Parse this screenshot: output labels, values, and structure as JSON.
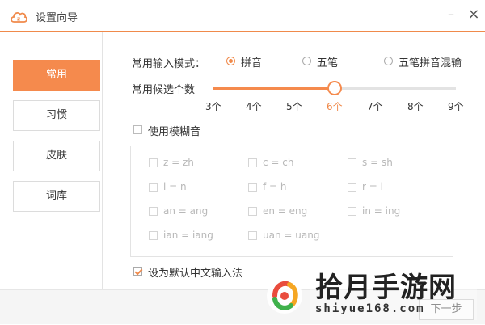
{
  "window": {
    "title": "设置向导"
  },
  "sidebar": {
    "items": [
      {
        "label": "常用",
        "active": true
      },
      {
        "label": "习惯",
        "active": false
      },
      {
        "label": "皮肤",
        "active": false
      },
      {
        "label": "词库",
        "active": false
      }
    ]
  },
  "input_mode": {
    "label": "常用输入模式：",
    "options": [
      {
        "label": "拼音",
        "checked": true
      },
      {
        "label": "五笔",
        "checked": false
      },
      {
        "label": "五笔拼音混输",
        "checked": false
      }
    ]
  },
  "candidates": {
    "label": "常用候选个数",
    "ticks": [
      "3个",
      "4个",
      "5个",
      "6个",
      "7个",
      "8个",
      "9个"
    ],
    "selected": "6个",
    "selected_index": 3
  },
  "fuzzy": {
    "label": "使用模糊音",
    "enabled": false,
    "pairs": [
      [
        "z = zh",
        "c = ch",
        "s = sh"
      ],
      [
        "l = n",
        "f = h",
        "r = l"
      ],
      [
        "an = ang",
        "en = eng",
        "in = ing"
      ],
      [
        "ian = iang",
        "uan = uang"
      ]
    ]
  },
  "default_ime": {
    "label": "设为默认中文输入法",
    "checked": true
  },
  "footer": {
    "next_label": "下一步"
  },
  "watermark": {
    "text": "拾月手游网",
    "url": "shiyue168.com"
  },
  "colors": {
    "accent": "#f58a4d"
  }
}
